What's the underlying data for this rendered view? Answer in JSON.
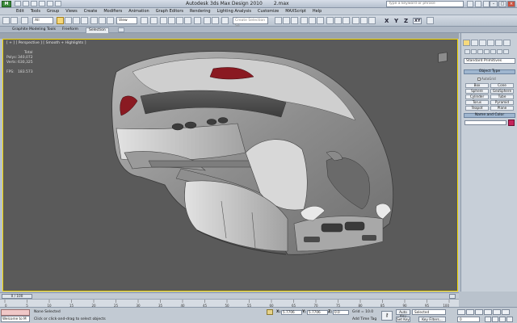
{
  "window": {
    "app_title": "Autodesk 3ds Max Design 2010",
    "file_name": "2.max",
    "search_placeholder": "Type a keyword or phrase",
    "logo_letter": "M"
  },
  "menu": [
    "Edit",
    "Tools",
    "Group",
    "Views",
    "Create",
    "Modifiers",
    "Animation",
    "Graph Editors",
    "Rendering",
    "Lighting Analysis",
    "Customize",
    "MAXScript",
    "Help"
  ],
  "toolbar": {
    "filter_value": "All",
    "refcoord_value": "View",
    "named_selection_placeholder": "Create Selection Se",
    "axis_labels": [
      "X",
      "Y",
      "Z",
      "XY"
    ]
  },
  "ribbon_tabs": [
    "Graphite Modeling Tools",
    "Freeform",
    "Selection"
  ],
  "viewport": {
    "label": "[ + ] [ Perspective ] [ Smooth + Highlights ]",
    "stats": {
      "header": "Total",
      "rows": [
        {
          "label": "Polys:",
          "value": "340,072"
        },
        {
          "label": "Verts:",
          "value": "630,325"
        },
        {
          "label": "FPS:",
          "value": "183.573"
        }
      ]
    }
  },
  "command_panel": {
    "dropdown_value": "Standard Primitives",
    "object_type_title": "Object Type",
    "autogrid_label": "AutoGrid",
    "objects": [
      "Box",
      "Cone",
      "Sphere",
      "GeoSphere",
      "Cylinder",
      "Tube",
      "Torus",
      "Pyramid",
      "Teapot",
      "Plane"
    ],
    "name_color_title": "Name and Color",
    "swatch_color": "#c4245c"
  },
  "timeline": {
    "thumb_label": "0 / 100",
    "ticks": [
      0,
      5,
      10,
      15,
      20,
      25,
      30,
      35,
      40,
      45,
      50,
      55,
      60,
      65,
      70,
      75,
      80,
      85,
      90,
      95,
      100
    ]
  },
  "status": {
    "maxscript_text": "Welcome to M",
    "selection_status": "None Selected",
    "prompt": "Click or click-and-drag to select objects",
    "coords": [
      {
        "axis": "X:",
        "value": "5.7706"
      },
      {
        "axis": "Y:",
        "value": "5.7706"
      },
      {
        "axis": "Z:",
        "value": "0.0"
      }
    ],
    "grid": "Grid = 10.0",
    "add_time_tag": "Add Time Tag",
    "auto_key": "Auto Key",
    "set_key": "Set Key",
    "selected_dropdown": "Selected",
    "key_filters": "Key Filters...",
    "frame_value": "0"
  }
}
